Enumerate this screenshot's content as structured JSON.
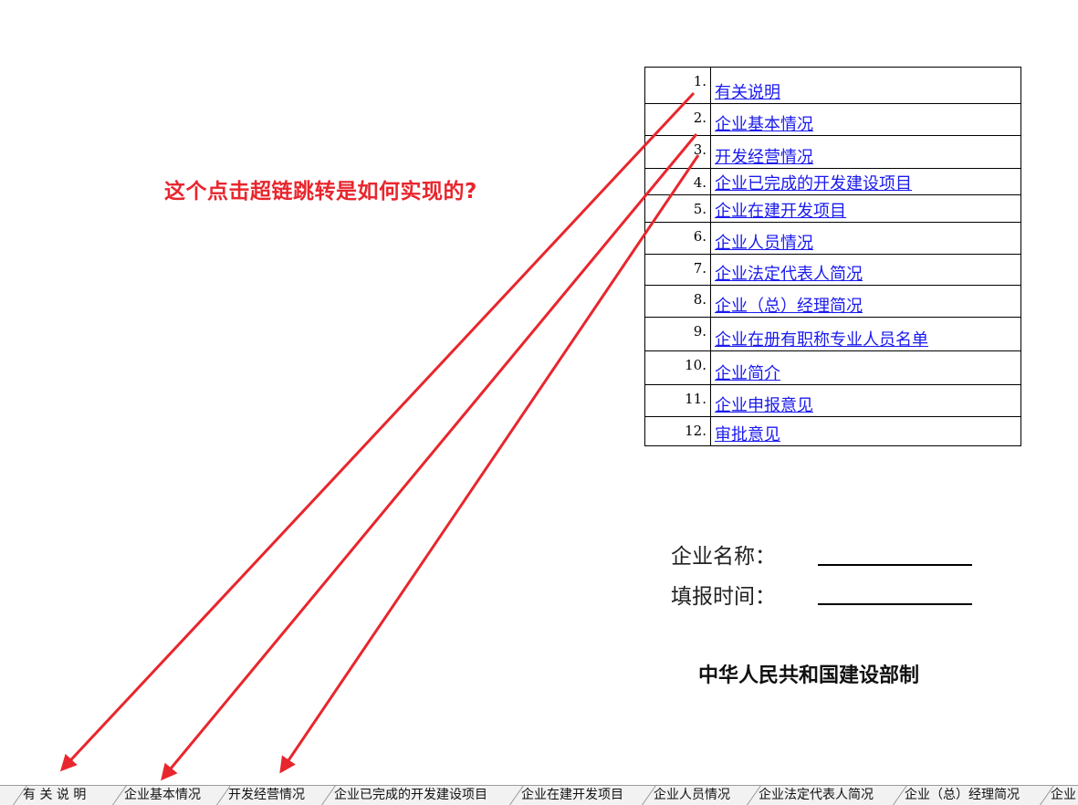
{
  "annotation": {
    "question": "这个点击超链跳转是如何实现的?"
  },
  "toc": [
    {
      "num": "1.",
      "label": "有关说明"
    },
    {
      "num": "2.",
      "label": "企业基本情况"
    },
    {
      "num": "3.",
      "label": "开发经营情况"
    },
    {
      "num": "4.",
      "label": "企业已完成的开发建设项目"
    },
    {
      "num": "5.",
      "label": "企业在建开发项目"
    },
    {
      "num": "6.",
      "label": "企业人员情况"
    },
    {
      "num": "7.",
      "label": "企业法定代表人简况"
    },
    {
      "num": "8.",
      "label": "企业（总）经理简况"
    },
    {
      "num": "9.",
      "label": "企业在册有职称专业人员名单"
    },
    {
      "num": "10.",
      "label": "企业简介"
    },
    {
      "num": "11.",
      "label": "企业申报意见"
    },
    {
      "num": "12.",
      "label": "审批意见"
    }
  ],
  "form": {
    "company_name_label": "企业名称：",
    "fill_date_label": "填报时间："
  },
  "footer": {
    "issuer": "中华人民共和国建设部制"
  },
  "sheet_tabs": [
    "有 关 说 明",
    "企业基本情况",
    "开发经营情况",
    "企业已完成的开发建设项目",
    "企业在建开发项目",
    "企业人员情况",
    "企业法定代表人简况",
    "企业（总）经理简况",
    "企业"
  ],
  "colors": {
    "arrow": "#e8262d",
    "link": "#1a1aef",
    "question": "#e8262d"
  }
}
